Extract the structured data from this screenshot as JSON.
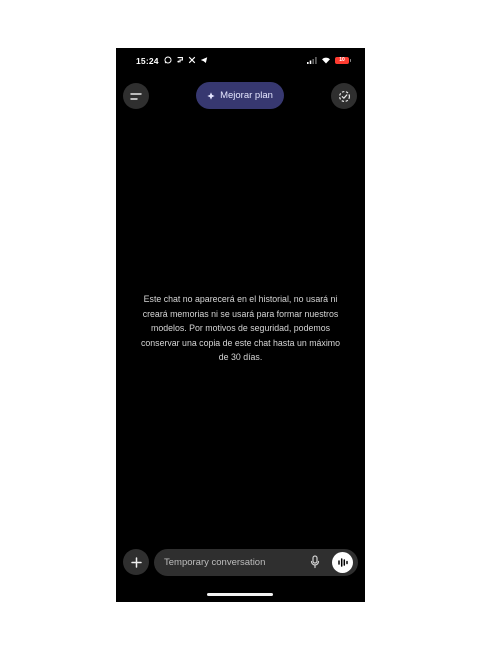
{
  "status_bar": {
    "time": "15:24",
    "battery_level": "10",
    "battery_color": "#ff3b30",
    "notification_icons": [
      "whatsapp-icon",
      "threads-icon",
      "x-icon",
      "telegram-icon"
    ]
  },
  "header": {
    "upgrade_label": "Mejorar plan",
    "accent_color": "#373870"
  },
  "main": {
    "notice": "Este chat no aparecerá en el historial, no usará ni creará memorias ni se usará para formar nuestros modelos. Por motivos de seguridad, podemos conservar una copia de este chat hasta un máximo de 30 días."
  },
  "composer": {
    "placeholder": "Temporary conversation",
    "value": ""
  }
}
